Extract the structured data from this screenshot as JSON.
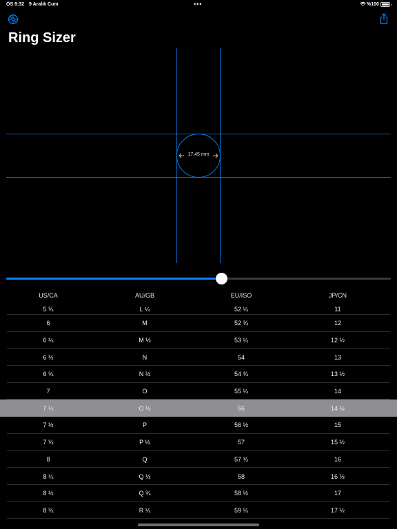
{
  "status_bar": {
    "time": "ÖS 9:32",
    "date": "9 Aralık Cum",
    "dots": "•••",
    "battery": "%100"
  },
  "toolbar": {
    "settings_icon": "gear-icon",
    "share_icon": "share-icon"
  },
  "page_title": "Ring Sizer",
  "measurement": {
    "diameter_label": "17.45 mm",
    "accent_color": "#0a84ff"
  },
  "slider": {
    "value_fraction": 0.56
  },
  "table": {
    "columns": [
      "US/CA",
      "AU/GB",
      "EU/ISO",
      "JP/CN"
    ],
    "rows": [
      [
        "5 ¾",
        "L ¼",
        "52 ¼",
        "11"
      ],
      [
        "6",
        "M",
        "52 ¾",
        "12"
      ],
      [
        "6 ¼",
        "M ½",
        "53 ¼",
        "12 ½"
      ],
      [
        "6 ½",
        "N",
        "54",
        "13"
      ],
      [
        "6 ¾",
        "N ½",
        "54 ¾",
        "13 ½"
      ],
      [
        "7",
        "O",
        "55 ¼",
        "14"
      ],
      [
        "7 ¼",
        "O ½",
        "56",
        "14 ½"
      ],
      [
        "7 ½",
        "P",
        "56 ½",
        "15"
      ],
      [
        "7 ¾",
        "P ½",
        "57",
        "15 ½"
      ],
      [
        "8",
        "Q",
        "57 ¾",
        "16"
      ],
      [
        "8 ¼",
        "Q ½",
        "58",
        "16 ½"
      ],
      [
        "8 ½",
        "Q ¾",
        "58 ½",
        "17"
      ],
      [
        "8 ¾",
        "R ¼",
        "59 ¼",
        "17 ½"
      ]
    ],
    "selected_row": 6,
    "selected_color": "#8e8e93"
  }
}
